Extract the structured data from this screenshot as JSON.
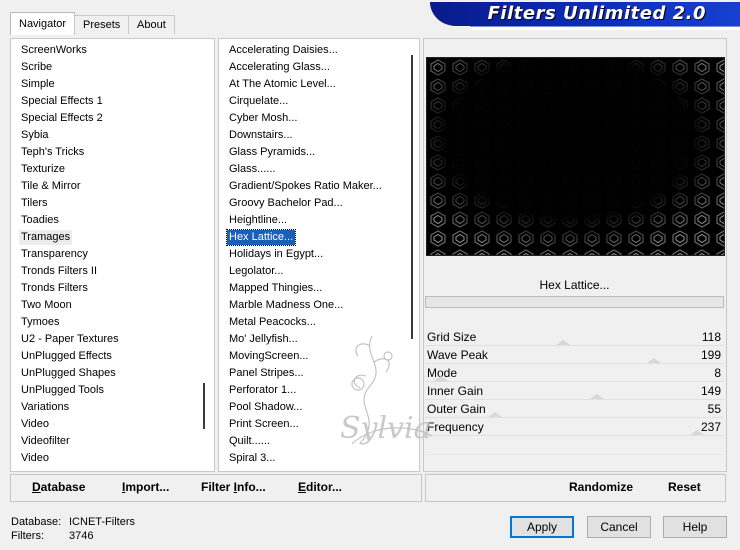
{
  "tabs": [
    {
      "label": "Navigator",
      "active": true
    },
    {
      "label": "Presets",
      "active": false
    },
    {
      "label": "About",
      "active": false
    }
  ],
  "banner": {
    "title": "Filters Unlimited 2.0"
  },
  "categories": {
    "items": [
      "ScreenWorks",
      "Scribe",
      "Simple",
      "Special Effects 1",
      "Special Effects 2",
      "Sybia",
      "Teph's Tricks",
      "Texturize",
      "Tile & Mirror",
      "Tilers",
      "Toadies",
      "Tramages",
      "Transparency",
      "Tronds Filters II",
      "Tronds Filters",
      "Two Moon",
      "Tymoes",
      "U2 - Paper Textures",
      "UnPlugged Effects",
      "UnPlugged Shapes",
      "UnPlugged Tools",
      "Variations",
      "Video",
      "Videofilter",
      "Video"
    ],
    "selected": "Tramages"
  },
  "filters": {
    "items": [
      "Accelerating Daisies...",
      "Accelerating Glass...",
      "At The Atomic Level...",
      "Cirquelate...",
      "Cyber Mosh...",
      "Downstairs...",
      "Glass Pyramids...",
      "Glass......",
      "Gradient/Spokes Ratio Maker...",
      "Groovy Bachelor Pad...",
      "Heightline...",
      "Hex Lattice...",
      "Holidays in Egypt...",
      "Legolator...",
      "Mapped Thingies...",
      "Marble Madness One...",
      "Metal Peacocks...",
      "Mo' Jellyfish...",
      "MovingScreen...",
      "Panel Stripes...",
      "Perforator 1...",
      "Pool Shadow...",
      "Print Screen...",
      "Quilt......",
      "Spiral 3..."
    ],
    "selected": "Hex Lattice..."
  },
  "preview": {
    "filter_name": "Hex Lattice...",
    "progress": 0
  },
  "parameters": [
    {
      "label": "Grid Size",
      "value": "118",
      "level": 0.46
    },
    {
      "label": "Wave Peak",
      "value": "199",
      "level": 0.78
    },
    {
      "label": "Mode",
      "value": "8",
      "level": 0.03
    },
    {
      "label": "Inner Gain",
      "value": "149",
      "level": 0.58
    },
    {
      "label": "Outer Gain",
      "value": "55",
      "level": 0.22
    },
    {
      "label": "Frequency",
      "value": "237",
      "level": 0.93
    }
  ],
  "toolbar": {
    "database": {
      "underline": "D",
      "rest": "atabase"
    },
    "import": {
      "underline": "I",
      "rest": "mport..."
    },
    "filter_info": {
      "pre": "Filter ",
      "underline": "I",
      "rest": "nfo..."
    },
    "editor": {
      "underline": "E",
      "rest": "ditor..."
    },
    "randomize": "Randomize",
    "reset": "Reset"
  },
  "info": {
    "database_label": "Database:",
    "database_value": "ICNET-Filters",
    "filters_label": "Filters:",
    "filters_value": "3746"
  },
  "buttons": {
    "apply": "Apply",
    "cancel": "Cancel",
    "help": "Help"
  },
  "watermark": {
    "text": "Sylvia"
  }
}
